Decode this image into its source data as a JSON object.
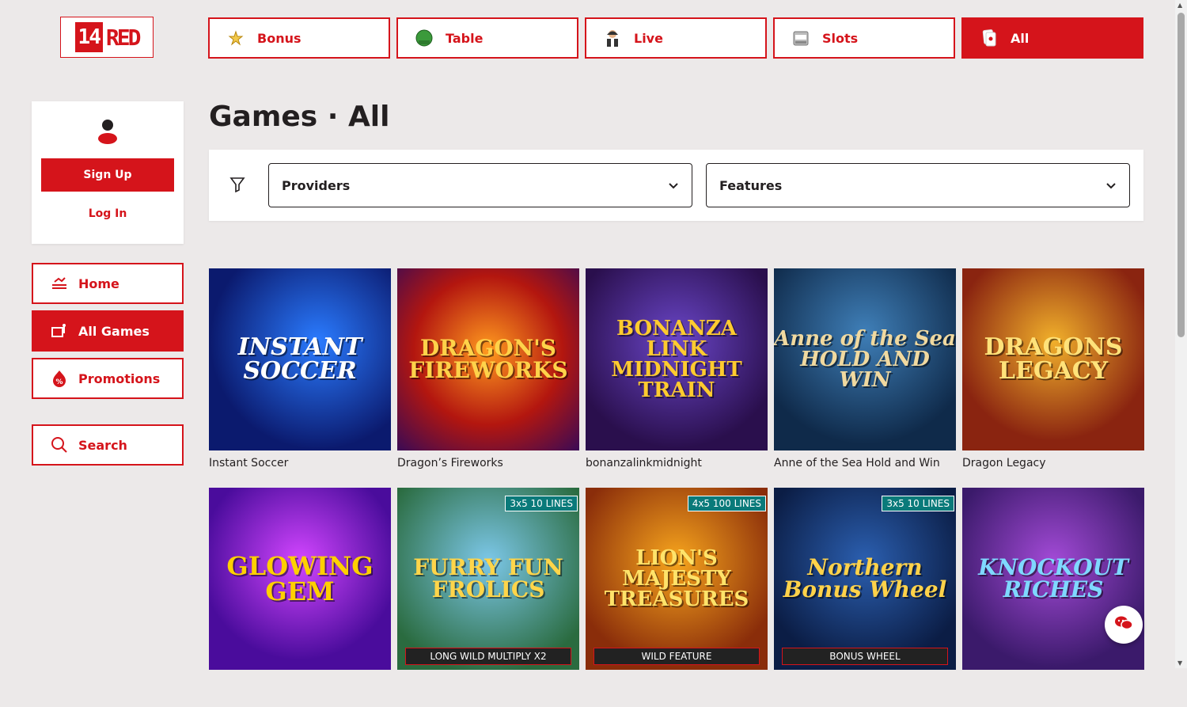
{
  "brand": {
    "num": "14",
    "name": "RED"
  },
  "topnav": [
    {
      "label": "Bonus",
      "icon": "bonus-icon"
    },
    {
      "label": "Table",
      "icon": "table-icon"
    },
    {
      "label": "Live",
      "icon": "live-dealer-icon"
    },
    {
      "label": "Slots",
      "icon": "slots-icon"
    },
    {
      "label": "All",
      "icon": "cards-icon",
      "active": true
    }
  ],
  "user": {
    "signup_label": "Sign Up",
    "login_label": "Log In"
  },
  "sidebar": [
    {
      "label": "Home",
      "icon": "home-icon"
    },
    {
      "label": "All Games",
      "icon": "all-games-icon",
      "active": true
    },
    {
      "label": "Promotions",
      "icon": "promotions-icon"
    },
    {
      "label": "Search",
      "icon": "search-icon"
    }
  ],
  "page": {
    "title": "Games · All"
  },
  "filters": {
    "providers": "Providers",
    "features": "Features"
  },
  "games": [
    {
      "name": "Instant Soccer",
      "art": "INSTANT SOCCER"
    },
    {
      "name": "Dragon’s Fireworks",
      "art": "DRAGON'S FIREWORKS"
    },
    {
      "name": "bonanzalinkmidnight",
      "art": "BONANZA LINK MIDNIGHT TRAIN"
    },
    {
      "name": "Anne of the Sea Hold and Win",
      "art": "Anne of the Sea HOLD AND WIN"
    },
    {
      "name": "Dragon Legacy",
      "art": "DRAGONS LEGACY"
    },
    {
      "name": "",
      "art": "GLOWING GEM"
    },
    {
      "name": "",
      "art": "FURRY FUN FROLICS",
      "badge": "3x5  10 LINES",
      "feature": "LONG WILD    MULTIPLY X2"
    },
    {
      "name": "",
      "art": "LION'S MAJESTY TREASURES",
      "badge": "4x5 100 LINES",
      "feature": "WILD FEATURE"
    },
    {
      "name": "",
      "art": "Northern Bonus Wheel",
      "badge": "3x5  10 LINES",
      "feature": "BONUS WHEEL"
    },
    {
      "name": "",
      "art": "KNOCKOUT RICHES"
    }
  ],
  "colors": {
    "accent": "#d5141b",
    "bg": "#ece9e9"
  }
}
